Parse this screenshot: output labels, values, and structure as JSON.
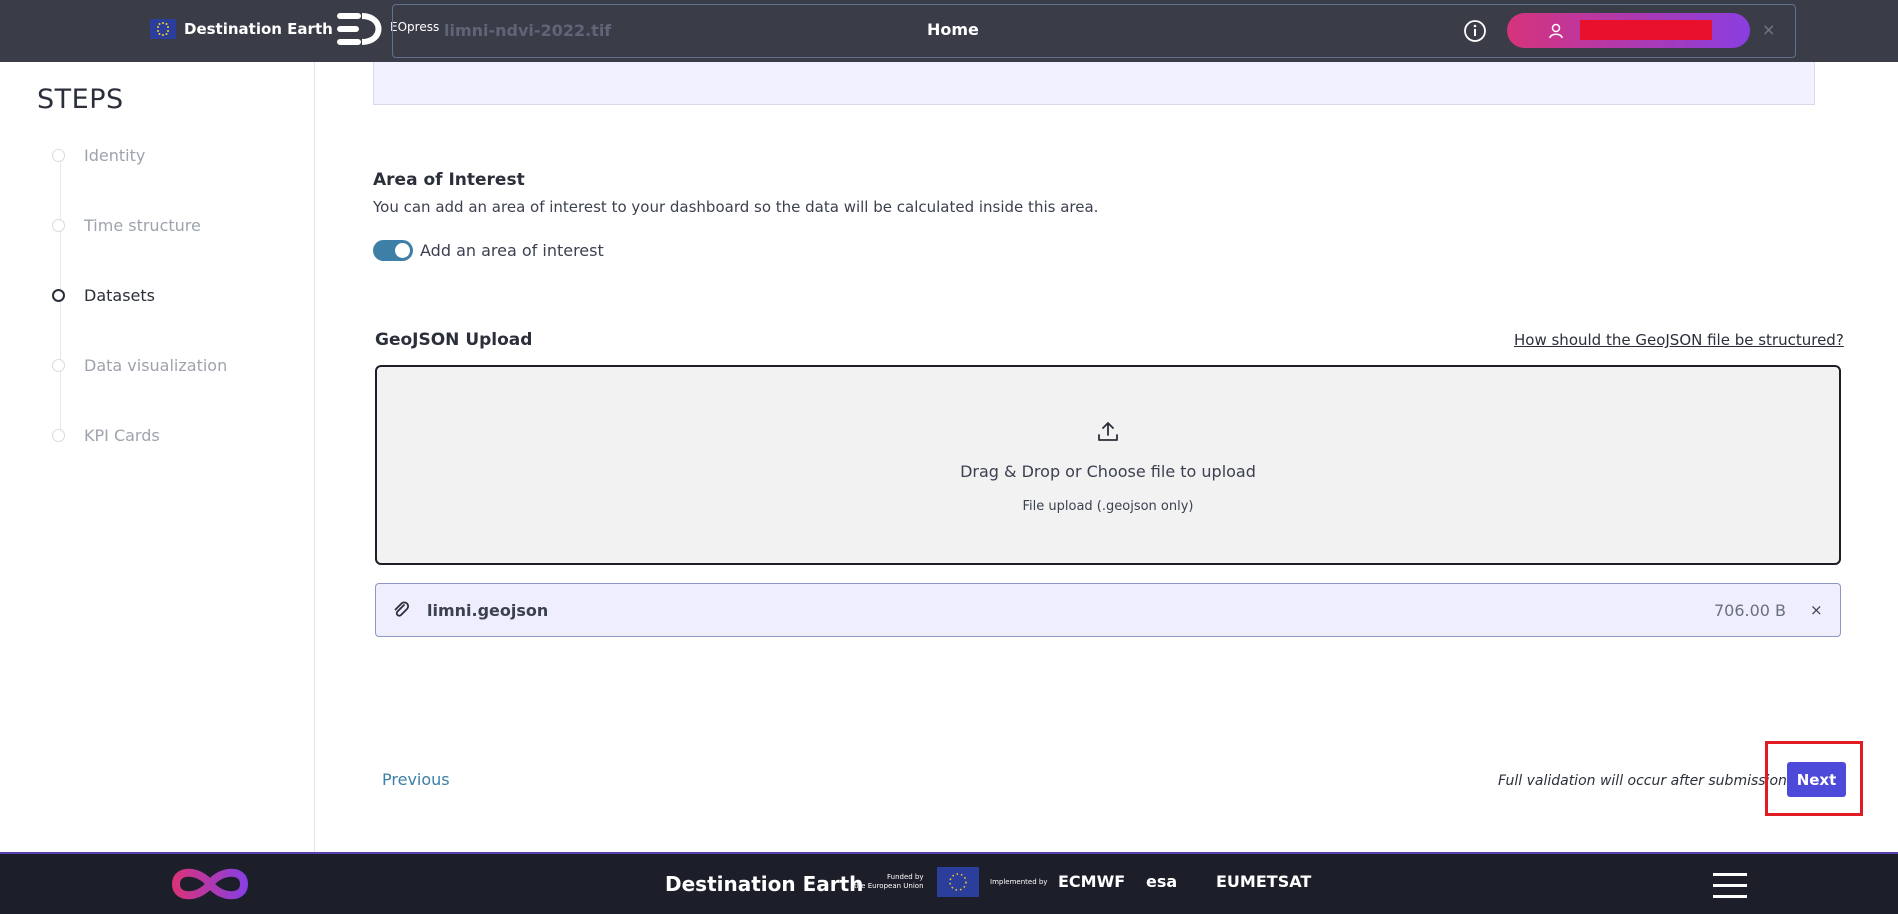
{
  "header": {
    "brand": "Destination Earth",
    "product": "EOpress",
    "title": "Home"
  },
  "overlay_file": {
    "name": "limni-ndvi-2022.tif"
  },
  "sidebar": {
    "title": "STEPS",
    "steps": [
      {
        "label": "Identity",
        "active": false
      },
      {
        "label": "Time structure",
        "active": false
      },
      {
        "label": "Datasets",
        "active": true
      },
      {
        "label": "Data visualization",
        "active": false
      },
      {
        "label": "KPI Cards",
        "active": false
      }
    ]
  },
  "aoi": {
    "title": "Area of Interest",
    "description": "You can add an area of interest to your dashboard so the data will be calculated inside this area.",
    "toggle_label": "Add an area of interest",
    "toggle_on": true
  },
  "geojson": {
    "title": "GeoJSON Upload",
    "help_link": "How should the GeoJSON file be structured?",
    "dropzone_text": "Drag & Drop or Choose file to upload",
    "dropzone_subtext": "File upload (.geojson only)",
    "file": {
      "name": "limni.geojson",
      "size": "706.00 B",
      "remove": "×"
    }
  },
  "nav": {
    "previous": "Previous",
    "validation_note": "Full validation will occur after submission.",
    "next": "Next"
  },
  "footer": {
    "title": "Destination Earth",
    "funded": [
      "Funded by",
      "the European Union"
    ],
    "implemented": "Implemented by",
    "orgs": [
      "ECMWF",
      "esa",
      "EUMETSAT"
    ]
  },
  "colors": {
    "header_bg": "#3a3d48",
    "accent_button": "#4e4ad9",
    "link": "#3d7fa6",
    "toggle": "#3d7fa6",
    "footer_bg": "#1c1e29",
    "highlight": "#e01b24"
  }
}
